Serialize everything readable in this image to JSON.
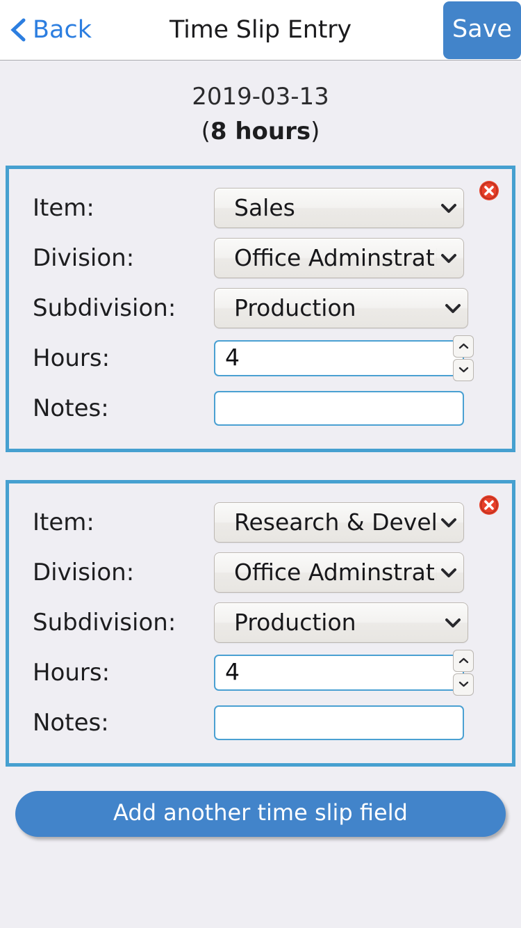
{
  "header": {
    "back_label": "Back",
    "back_icon": "chevron-left-icon",
    "title": "Time Slip Entry",
    "save_label": "Save",
    "accent_color": "#4284ca",
    "link_color": "#2c7ee0"
  },
  "summary": {
    "date": "2019-03-13",
    "hours_prefix": "(",
    "hours_value": "8 hours",
    "hours_suffix": ")"
  },
  "labels": {
    "item": "Item:",
    "division": "Division:",
    "subdivision": "Subdivision:",
    "hours": "Hours:",
    "notes": "Notes:"
  },
  "card_style": {
    "border_color": "#46a0d0",
    "input_border_color": "#4aa0d2",
    "delete_icon": "delete-circle-icon",
    "delete_color": "#e8402a"
  },
  "slips": [
    {
      "item": "Sales",
      "division": "Office Adminstration",
      "subdivision": "Production",
      "hours": "4",
      "notes": "",
      "notes_placeholder": ""
    },
    {
      "item": "Research & Development",
      "division": "Office Adminstration",
      "subdivision": "Production",
      "hours": "4",
      "notes": "",
      "notes_placeholder": ""
    }
  ],
  "footer": {
    "add_label": "Add another time slip field"
  }
}
